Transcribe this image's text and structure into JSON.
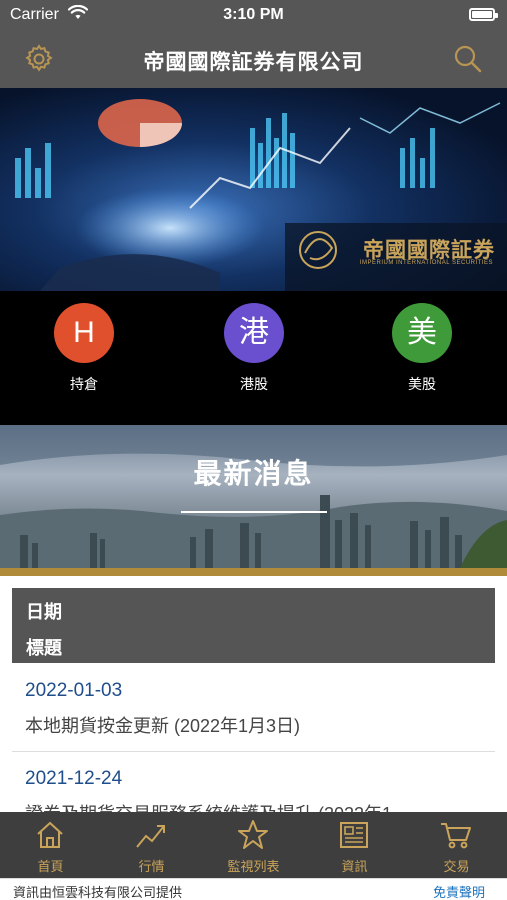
{
  "status_bar": {
    "carrier": "Carrier",
    "time": "3:10 PM",
    "battery_level": 1.0
  },
  "header": {
    "title": "帝國國際証券有限公司",
    "settings_icon": "gear-icon",
    "search_icon": "search-icon"
  },
  "banner": {
    "brand_name": "帝國國際証券",
    "brand_subtitle": "IMPERIUM INTERNATIONAL SECURITIES"
  },
  "quick_links": [
    {
      "glyph": "H",
      "label": "持倉",
      "color": "#e0502c"
    },
    {
      "glyph": "港",
      "label": "港股",
      "color": "#6a4fcf"
    },
    {
      "glyph": "美",
      "label": "美股",
      "color": "#3f9a3a"
    }
  ],
  "news": {
    "section_title": "最新消息",
    "column_date": "日期",
    "column_title": "標題",
    "items": [
      {
        "date": "2022-01-03",
        "headline": "本地期貨按金更新 (2022年1月3日)"
      },
      {
        "date": "2021-12-24",
        "headline": "證券及期貨交易服務系統維護及提升 (2022年1"
      }
    ]
  },
  "tabs": [
    {
      "label": "首頁",
      "icon": "home-icon"
    },
    {
      "label": "行情",
      "icon": "trend-icon"
    },
    {
      "label": "監視列表",
      "icon": "star-icon"
    },
    {
      "label": "資訊",
      "icon": "newspaper-icon"
    },
    {
      "label": "交易",
      "icon": "cart-icon"
    }
  ],
  "footer": {
    "provider": "資訊由恒雲科技有限公司提供",
    "disclaimer": "免責聲明"
  },
  "colors": {
    "header_bg": "#565656",
    "accent_gold": "#c9a45a",
    "date_blue": "#1f4e8c",
    "tabbar_bg": "#3e3e3e"
  }
}
